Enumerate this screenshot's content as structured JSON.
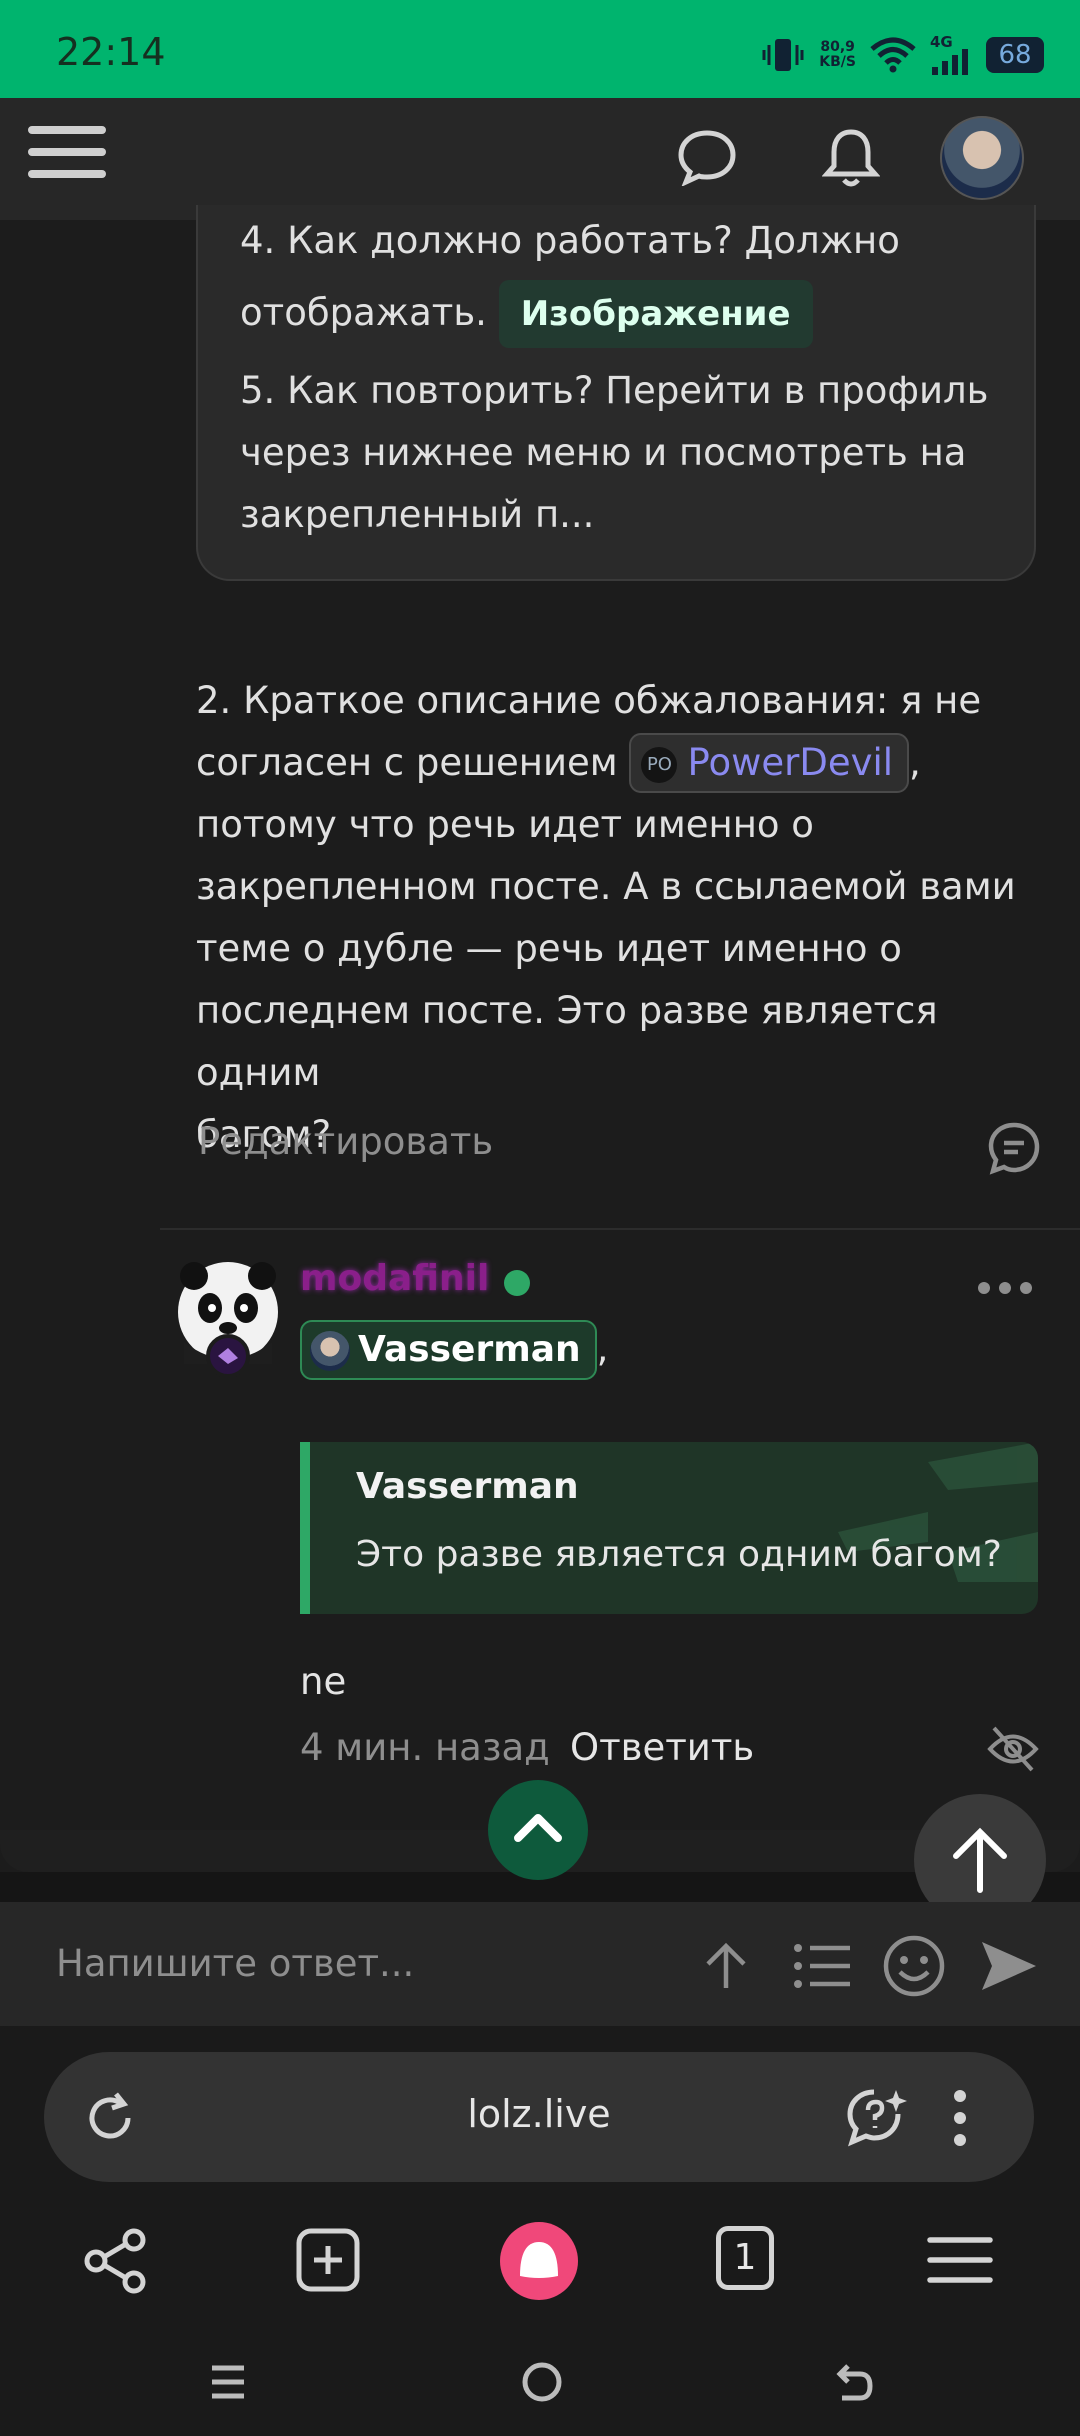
{
  "status_bar": {
    "time": "22:14",
    "net_speed_value": "80,9",
    "net_speed_unit": "KB/S",
    "network_type": "4G",
    "battery": "68"
  },
  "post": {
    "item4": "4. Как должно работать? Должно",
    "item4_cont": "отображать.",
    "image_chip": "Изображение",
    "item5_lines": [
      "5. Как повторить? Перейти в профиль",
      "через нижнее меню и посмотреть на",
      "закрепленный п..."
    ],
    "p2_line1": "2. Краткое описание обжалования: я не",
    "p2_line2_pre": "согласен с решением",
    "mention_badge": "PO",
    "mention_name": "PowerDevil",
    "p2_line2_post": ",",
    "p2_rest": [
      "потому что речь идет именно о",
      "закрепленном посте. А в ссылаемой вами",
      "теме о дубле — речь идет именно о",
      "последнем посте. Это разве является одним",
      "багом?"
    ],
    "edit_label": "Редактировать"
  },
  "reply": {
    "username": "modafinil",
    "mention_name": "Vasserman",
    "mention_suffix": ",",
    "quote_author": "Vasserman",
    "quote_text": "Это разве является одним багом?",
    "body": "ne",
    "time": "4 мин. назад",
    "reply_label": "Ответить"
  },
  "composer": {
    "placeholder": "Напишите ответ..."
  },
  "browser": {
    "url": "lolz.live",
    "tab_count": "1"
  },
  "colors": {
    "status_green": "#00b46e",
    "accent_green": "#2ea866",
    "mention_purple": "#8a8af0",
    "alice_pink": "#f0487a"
  }
}
